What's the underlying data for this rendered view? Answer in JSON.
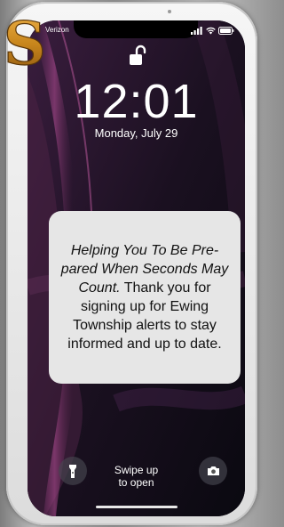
{
  "status_bar": {
    "carrier": "Verizon",
    "icons": [
      "signal-bars-icon",
      "wifi-icon",
      "battery-icon"
    ]
  },
  "lock_screen": {
    "lock_icon": "unlocked-padlock-icon",
    "time": "12:01",
    "date": "Monday, July 29"
  },
  "notification": {
    "italic_text": "Helping You To Be Pre-pared When Seconds May Count.",
    "body_text": " Thank you for signing up for Ewing Township alerts to stay informed and up to date."
  },
  "bottom": {
    "swipe_line1": "Swipe up",
    "swipe_line2": "to open",
    "left_button_icon": "flashlight-icon",
    "right_button_icon": "camera-icon"
  },
  "logo": {
    "letter": "S",
    "color": "#c8861c"
  },
  "colors": {
    "notification_bg": "#e6e6e6",
    "screen_bg": "#0c0a14",
    "frame": "#eeeeee"
  }
}
